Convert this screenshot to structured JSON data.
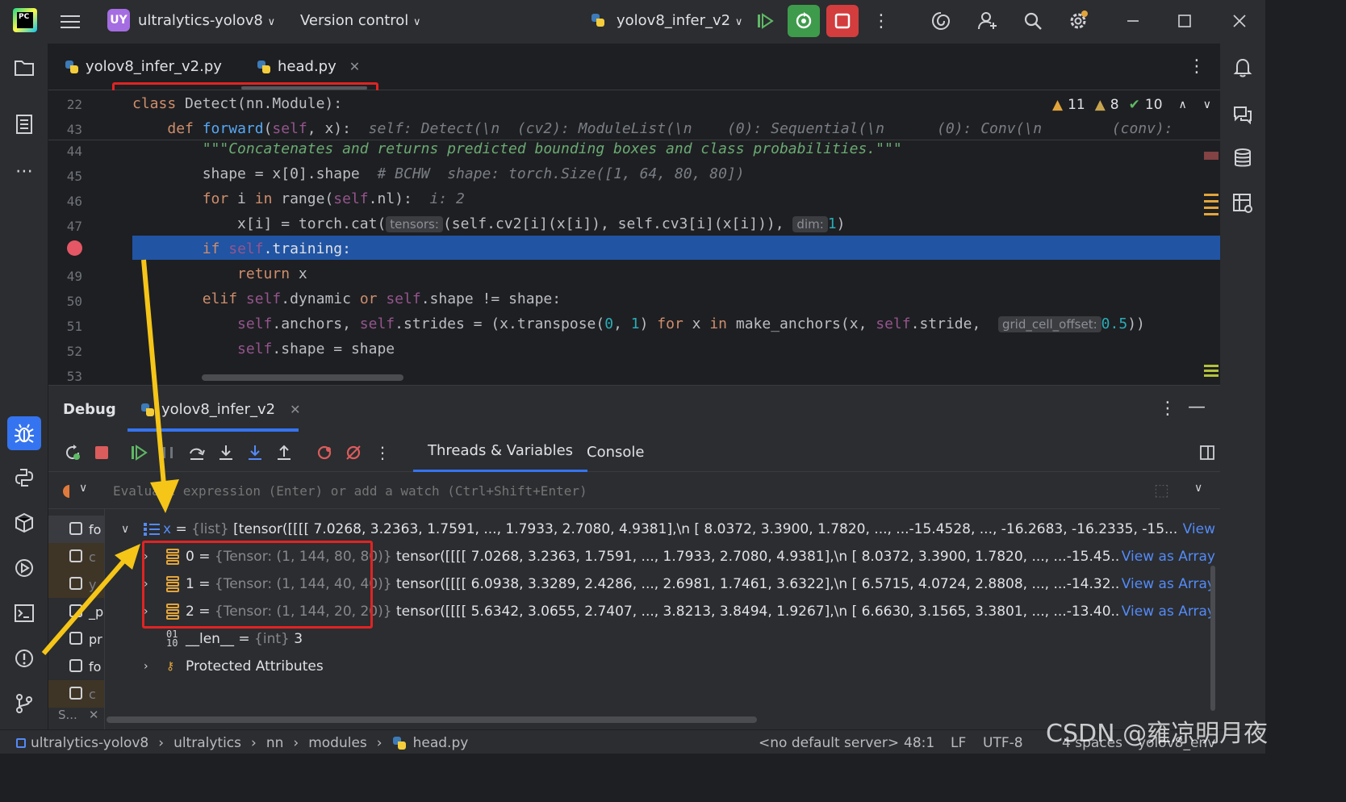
{
  "titlebar": {
    "app_logo_text": "PC",
    "project_badge": "UY",
    "project_name": "ultralytics-yolov8",
    "version_control": "Version control",
    "run_config": "yolov8_infer_v2"
  },
  "editor_tabs": [
    {
      "label": "yolov8_infer_v2.py"
    },
    {
      "label": "head.py"
    }
  ],
  "inspections": {
    "warnings": "11",
    "weak_warnings": "8",
    "ok": "10"
  },
  "sticky_lines": [
    {
      "num": "22",
      "code": "class Detect(nn.Module):"
    },
    {
      "num": "43",
      "code": "def forward(self, x):",
      "inline": "self: Detect(\\n  (cv2): ModuleList(\\n    (0): Sequential(\\n      (0): Conv(\\n        (conv):"
    }
  ],
  "code_lines": [
    {
      "num": "44",
      "text": "\"\"\"Concatenates and returns predicted bounding boxes and class probabilities.\"\"\""
    },
    {
      "num": "45",
      "a": "shape = x[0].shape",
      "comment": "# BCHW",
      "inline": "shape: torch.Size([1, 64, 80, 80])"
    },
    {
      "num": "46",
      "a": "for",
      "b": " i ",
      "c": "in",
      "d": " range(",
      "e": "self",
      "f": ".nl):",
      "inline": "i: 2"
    },
    {
      "num": "47",
      "a": "x[i] = torch.cat(",
      "hint1": "tensors:",
      "b": "(self.cv2[i](x[i]), self.cv3[i](x[i])),",
      "hint2": "dim:",
      "c": "1",
      "d": ")"
    },
    {
      "num": "48",
      "text": "if self.training:"
    },
    {
      "num": "49",
      "text": "return x"
    },
    {
      "num": "50",
      "text": "elif self.dynamic or self.shape != shape:"
    },
    {
      "num": "51",
      "a": "self.anchors, self.strides = (x.transpose(0, 1) for x in make_anchors(x, self.stride,",
      "hint": "grid_cell_offset:",
      "b": "0.5",
      "c": "))"
    },
    {
      "num": "52",
      "text": "self.shape = shape"
    },
    {
      "num": "53",
      "text": ""
    }
  ],
  "debug": {
    "title": "Debug",
    "session_tab": "yolov8_infer_v2",
    "tab_threads": "Threads & Variables",
    "tab_console": "Console",
    "eval_placeholder": "Evaluate expression (Enter) or add a watch (Ctrl+Shift+Enter)"
  },
  "frames": [
    {
      "label": "fo"
    },
    {
      "label": "c"
    },
    {
      "label": "y"
    },
    {
      "label": "_p"
    },
    {
      "label": "pr"
    },
    {
      "label": "fo"
    },
    {
      "label": "c"
    }
  ],
  "frames_footer": "S...",
  "variables": {
    "x": {
      "name": "x",
      "type": "{list}",
      "value": "[tensor([[[[  7.0268,   3.2363,   1.7591,  ...,   1.7933,   2.7080,   4.9381],\\n          [  8.0372,   3.3900,   1.7820,  ..., ...-15.4528,  ..., -16.2683, -16.2335, -15...",
      "link": "View"
    },
    "children": [
      {
        "index": "0",
        "type": "{Tensor: (1, 144, 80, 80)}",
        "value": "tensor([[[[  7.0268,   3.2363,   1.7591,  ...,   1.7933,   2.7080,   4.9381],\\n          [  8.0372,   3.3900,   1.7820,  ..., ...-15.45...",
        "link": "View as Array"
      },
      {
        "index": "1",
        "type": "{Tensor: (1, 144, 40, 40)}",
        "value": "tensor([[[[  6.0938,   3.3289,   2.4286,  ...,   2.6981,   1.7461,   3.6322],\\n          [  6.5715,   4.0724,   2.8808,  ..., ...-14.32...",
        "link": "View as Array"
      },
      {
        "index": "2",
        "type": "{Tensor: (1, 144, 20, 20)}",
        "value": "tensor([[[[  5.6342,   3.0655,   2.7407,  ...,   3.8213,   3.8494,   1.9267],\\n          [  6.6630,   3.1565,   3.3801,  ..., ...-13.40...",
        "link": "View as Array"
      }
    ],
    "len": {
      "name": "__len__",
      "type": "{int}",
      "value": "3"
    },
    "protected": "Protected Attributes"
  },
  "statusbar": {
    "breadcrumbs": [
      "ultralytics-yolov8",
      "ultralytics",
      "nn",
      "modules",
      "head.py"
    ],
    "server": "<no default server>",
    "position": "48:1",
    "line_sep": "LF",
    "encoding": "UTF-8",
    "indent": "4 spaces",
    "interpreter": "yolov8_env"
  },
  "watermark": "CSDN @雍凉明月夜",
  "colors": {
    "accent": "#3574f0",
    "exec_line": "#2154a3",
    "annotation": "#e02424",
    "arrow": "#f5c518"
  }
}
